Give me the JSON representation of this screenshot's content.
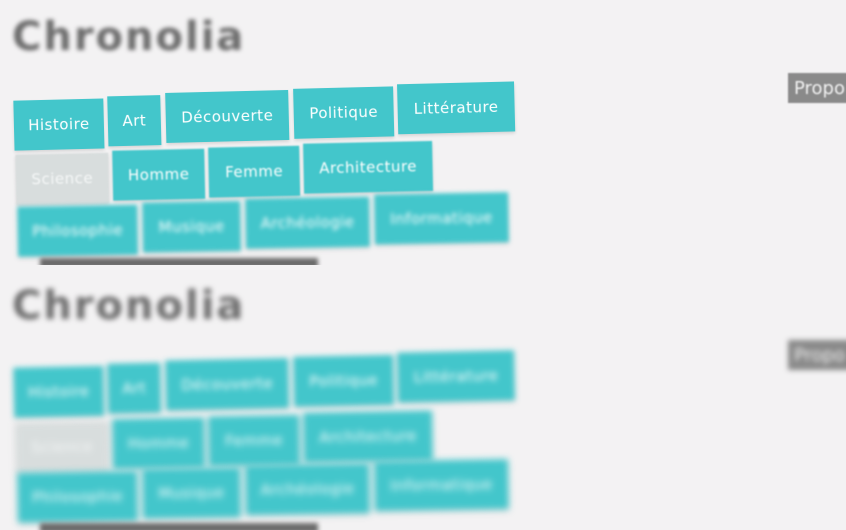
{
  "app": {
    "title": "Chronolia"
  },
  "categories": {
    "row1": [
      "Histoire",
      "Art",
      "Découverte",
      "Politique",
      "Littérature"
    ],
    "row2": [
      "Science",
      "Homme",
      "Femme",
      "Architecture"
    ],
    "row3": [
      "Philosophie",
      "Musique",
      "Archéologie",
      "Informatique"
    ]
  },
  "propose_label": "Propo",
  "colors": {
    "tag": "#43c6cb",
    "tag_inactive": "#d8dddd",
    "title": "#6d6d6d",
    "background": "#f3f2f3"
  }
}
